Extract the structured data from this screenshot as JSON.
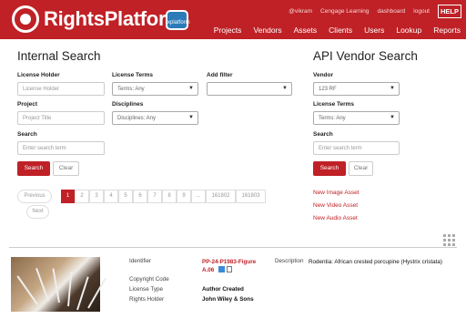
{
  "header": {
    "brand": "RightsPlatform",
    "badge": "xplatform",
    "user": "@vikram",
    "org": "Cengage Learning",
    "dashboard": "dashboard",
    "logout": "logout",
    "help": "HELP",
    "nav": [
      "Projects",
      "Vendors",
      "Assets",
      "Clients",
      "Users",
      "Lookup",
      "Reports"
    ]
  },
  "internal": {
    "title": "Internal Search",
    "license_holder_label": "License Holder",
    "license_holder_placeholder": "License Holder",
    "license_terms_label": "License Terms",
    "license_terms_value": "Terms: Any",
    "add_filter_label": "Add filter",
    "add_filter_value": "",
    "project_label": "Project",
    "project_placeholder": "Project Title",
    "disciplines_label": "Disciplines",
    "disciplines_value": "Disciplines: Any",
    "search_label": "Search",
    "search_placeholder": "Enter search term",
    "search_btn": "Search",
    "clear_btn": "Clear"
  },
  "pagination": {
    "previous": "Previous",
    "next": "Next",
    "pages": [
      "1",
      "2",
      "3",
      "4",
      "5",
      "6",
      "7",
      "8",
      "9",
      "...",
      "161802",
      "161803"
    ]
  },
  "vendor": {
    "title": "API Vendor Search",
    "vendor_label": "Vendor",
    "vendor_value": "123 RF",
    "terms_label": "License Terms",
    "terms_value": "Terms: Any",
    "search_label": "Search",
    "search_placeholder": "Enter search term",
    "search_btn": "Search",
    "clear_btn": "Clear",
    "links": [
      "New Image Asset",
      "New Video Asset",
      "New Audio Asset"
    ]
  },
  "asset": {
    "identifier_label": "Identifier",
    "identifier_value": "PP-24-P1983-Figure A.06",
    "copyright_label": "Copyright Code",
    "copyright_value": "",
    "license_type_label": "License Type",
    "license_type_value": "Author Created",
    "rights_holder_label": "Rights Holder",
    "rights_holder_value": "John Wiley & Sons",
    "description_label": "Description",
    "description_value": "Rodentia: African crested porcupine (Hystrix cristata)"
  },
  "colors": {
    "brand": "#bf2126",
    "badge": "#2b7bb8"
  }
}
